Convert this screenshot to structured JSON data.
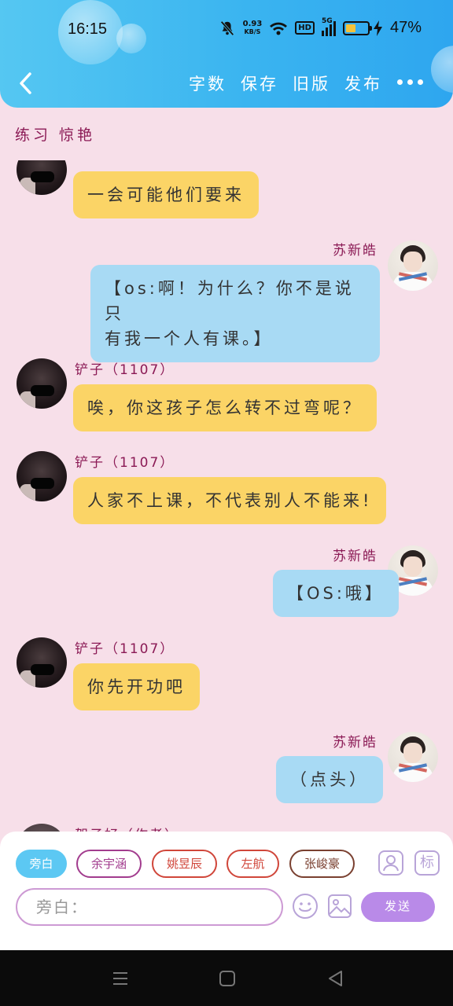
{
  "status_bar": {
    "time": "16:15",
    "net_speed_value": "0.93",
    "net_speed_unit": "KB/S",
    "hd_label": "HD",
    "signal_label": "5G",
    "battery_percent": "47%",
    "battery_level": 0.47
  },
  "header": {
    "menu": [
      "字数",
      "保存",
      "旧版",
      "发布"
    ]
  },
  "chat_title": "练习 惊艳",
  "messages": [
    {
      "side": "left",
      "name": "",
      "text": "一会可能他们要来"
    },
    {
      "side": "right",
      "name": "苏新皓",
      "text_lines": [
        "【os:啊！为什么？你不是说只",
        "有我一个人有课。】"
      ]
    },
    {
      "side": "left",
      "name": "铲子（1107）",
      "text": "唉，你这孩子怎么转不过弯呢？"
    },
    {
      "side": "left",
      "name": "铲子（1107）",
      "text": "人家不上课，不代表别人不能来!"
    },
    {
      "side": "right",
      "name": "苏新皓",
      "text": "【OS:哦】"
    },
    {
      "side": "left",
      "name": "铲子（1107）",
      "text": "你先开功吧"
    },
    {
      "side": "right",
      "name": "苏新皓",
      "text": "（点头）"
    },
    {
      "side": "left",
      "name": "贺子好（作者）",
      "text": ""
    }
  ],
  "roles": [
    {
      "label": "旁白",
      "active": true,
      "color": "#5cc8f3"
    },
    {
      "label": "余宇涵",
      "active": false,
      "color": "#a23c8e"
    },
    {
      "label": "姚昱辰",
      "active": false,
      "color": "#d0463a"
    },
    {
      "label": "左航",
      "active": false,
      "color": "#d0463a"
    },
    {
      "label": "张峻豪",
      "active": false,
      "color": "#7a4030"
    }
  ],
  "input": {
    "placeholder": "旁白：",
    "send_label": "发送",
    "tag_icon_label": "标"
  },
  "colors": {
    "header": "#3ab4f0",
    "background": "#f7dfe9",
    "bubble_left": "#fbd466",
    "bubble_right": "#a8daf4",
    "name": "#8b1a55",
    "send": "#b98ae8"
  }
}
